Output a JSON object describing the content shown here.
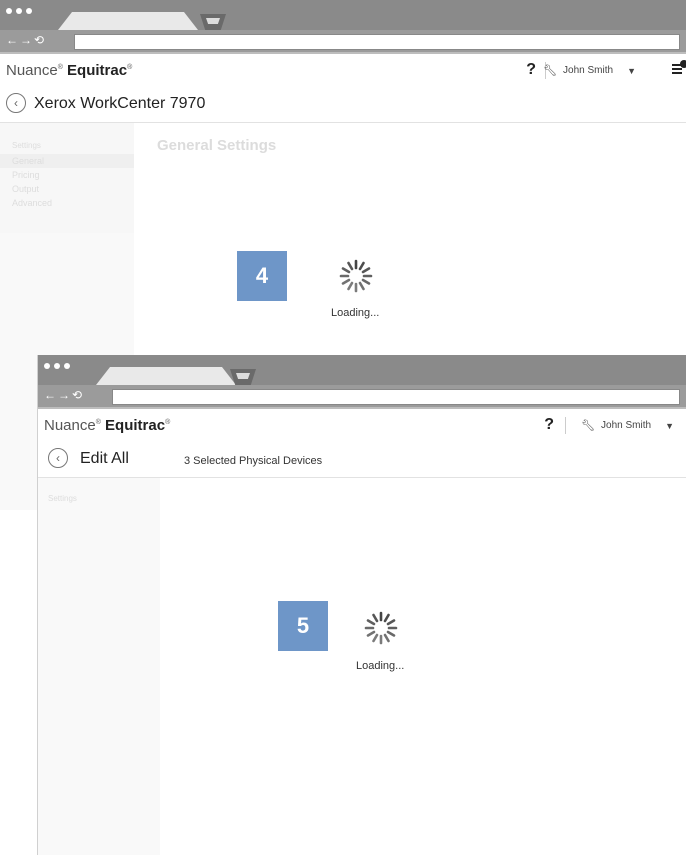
{
  "window1": {
    "brand": {
      "prefix": "Nuance",
      "suffix": "Equitrac"
    },
    "header": {
      "help": "?",
      "user": "John Smith"
    },
    "title": "Xerox WorkCenter 7970",
    "sidebar": {
      "heading": "Settings",
      "items": [
        "General",
        "Pricing",
        "Output",
        "Advanced"
      ],
      "selected": "General"
    },
    "content_title": "General Settings",
    "step": "4",
    "loading": "Loading..."
  },
  "window2": {
    "brand": {
      "prefix": "Nuance",
      "suffix": "Equitrac"
    },
    "header": {
      "help": "?",
      "user": "John Smith"
    },
    "title": "Edit All",
    "subtitle": "3 Selected Physical Devices",
    "sidebar": {
      "heading": "Settings"
    },
    "step": "5",
    "loading": "Loading..."
  },
  "colors": {
    "badge": "#6e96c8",
    "chrome": "#7a7a7a"
  },
  "icons": {
    "back": "chevron-left-icon",
    "wrench": "wrench-icon",
    "caret": "caret-down-icon",
    "menu": "menu-icon",
    "spinner": "spinner-icon"
  }
}
